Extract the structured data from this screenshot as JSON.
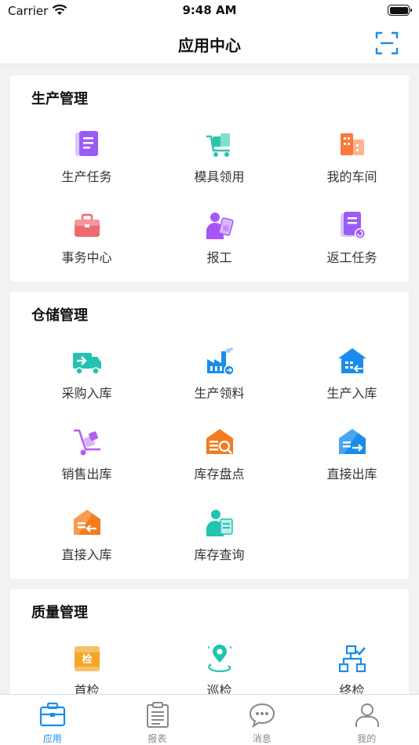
{
  "status_bar": {
    "carrier": "Carrier",
    "time": "9:48 AM"
  },
  "nav": {
    "title": "应用中心",
    "scan_icon": "scan-icon"
  },
  "sections": [
    {
      "title": "生产管理",
      "items": [
        {
          "label": "生产任务",
          "icon": "task-document-icon",
          "color": "#9b5cf6"
        },
        {
          "label": "模具领用",
          "icon": "mold-cart-icon",
          "color": "#2ec4a9"
        },
        {
          "label": "我的车间",
          "icon": "workshop-buildings-icon",
          "color": "#f97a3c"
        },
        {
          "label": "事务中心",
          "icon": "briefcase-icon",
          "color": "#ee6a6f"
        },
        {
          "label": "报工",
          "icon": "report-work-person-icon",
          "color": "#a855f7"
        },
        {
          "label": "返工任务",
          "icon": "rework-document-icon",
          "color": "#9b5cf6"
        }
      ]
    },
    {
      "title": "仓储管理",
      "items": [
        {
          "label": "采购入库",
          "icon": "delivery-truck-icon",
          "color": "#22c3b0"
        },
        {
          "label": "生产领料",
          "icon": "factory-icon",
          "color": "#1a8ceb"
        },
        {
          "label": "生产入库",
          "icon": "warehouse-in-icon",
          "color": "#1a8ceb"
        },
        {
          "label": "销售出库",
          "icon": "hand-truck-icon",
          "color": "#b45cf0"
        },
        {
          "label": "库存盘点",
          "icon": "inventory-check-icon",
          "color": "#f47b20"
        },
        {
          "label": "直接出库",
          "icon": "warehouse-out-icon",
          "color": "#1a8ceb"
        },
        {
          "label": "直接入库",
          "icon": "warehouse-direct-in-icon",
          "color": "#f47b20"
        },
        {
          "label": "库存查询",
          "icon": "inventory-query-person-icon",
          "color": "#22c3b0"
        }
      ]
    },
    {
      "title": "质量管理",
      "items": [
        {
          "label": "首检",
          "icon": "first-inspection-icon",
          "color": "#f5a623",
          "badge": "检"
        },
        {
          "label": "巡检",
          "icon": "patrol-location-icon",
          "color": "#22c3b0"
        },
        {
          "label": "终检",
          "icon": "final-inspection-flow-icon",
          "color": "#1a8ceb"
        }
      ]
    }
  ],
  "tabbar": [
    {
      "label": "应用",
      "icon": "briefcase-tab-icon",
      "active": true
    },
    {
      "label": "报表",
      "icon": "clipboard-tab-icon",
      "active": false
    },
    {
      "label": "消息",
      "icon": "chat-bubble-tab-icon",
      "active": false
    },
    {
      "label": "我的",
      "icon": "user-tab-icon",
      "active": false
    }
  ],
  "colors": {
    "accent": "#1a8ceb",
    "background": "#f2f2f5"
  }
}
